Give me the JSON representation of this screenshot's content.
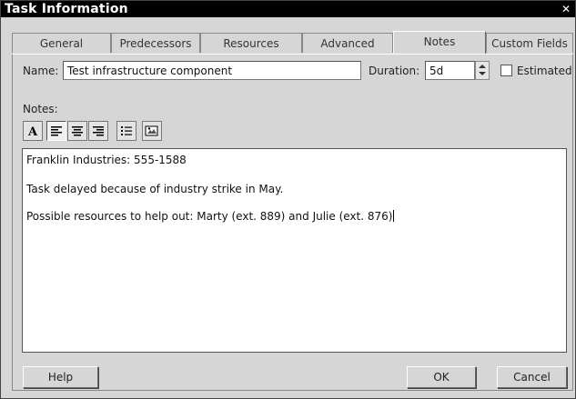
{
  "window": {
    "title": "Task Information",
    "close_glyph": "✕"
  },
  "tabs": [
    {
      "label": "General"
    },
    {
      "label": "Predecessors"
    },
    {
      "label": "Resources"
    },
    {
      "label": "Advanced"
    },
    {
      "label": "Notes",
      "active": true
    },
    {
      "label": "Custom Fields"
    }
  ],
  "form": {
    "name_label": "Name:",
    "name_value": "Test infrastructure component",
    "duration_label": "Duration:",
    "duration_value": "5d",
    "estimated_label": "Estimated",
    "estimated_checked": false
  },
  "notes": {
    "label": "Notes:",
    "toolbar": [
      {
        "icon": "font-icon"
      },
      {
        "icon": "align-left-icon",
        "pressed": true
      },
      {
        "icon": "align-center-icon"
      },
      {
        "icon": "align-right-icon"
      },
      {
        "icon": "bulleted-list-icon"
      },
      {
        "icon": "insert-object-icon"
      }
    ],
    "lines": [
      "Franklin Industries: 555-1588",
      "",
      "Task delayed because of industry strike in May.",
      "",
      "Possible resources to help out: Marty (ext. 889) and Julie (ext. 876)"
    ]
  },
  "buttons": {
    "help": "Help",
    "ok": "OK",
    "cancel": "Cancel"
  }
}
